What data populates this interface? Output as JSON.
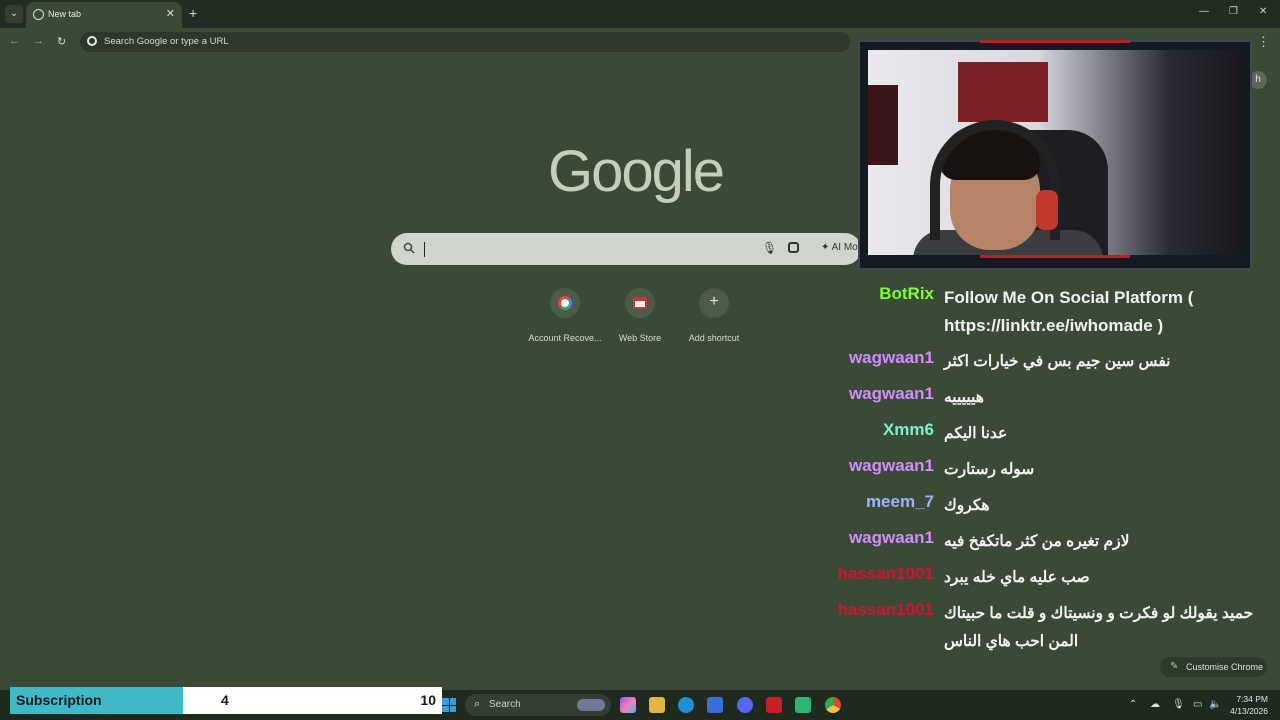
{
  "browser": {
    "tab_title": "New tab",
    "omnibox_placeholder": "Search Google or type a URL",
    "profile_initial": "h"
  },
  "ntp": {
    "logo_text": "Google",
    "search_ai_mode_label": "AI Mo",
    "shortcuts": [
      {
        "label": "Account Recove...",
        "icon": "google-icon"
      },
      {
        "label": "Web Store",
        "icon": "web-store-icon"
      },
      {
        "label": "Add shortcut",
        "icon": "plus-icon"
      }
    ],
    "customise_label": "Customise Chrome"
  },
  "chat": {
    "messages": [
      {
        "user": "BotRix",
        "color": "#7cfc3a",
        "text": "Follow Me On Social Platform ( https://linktr.ee/iwhomade )"
      },
      {
        "user": "wagwaan1",
        "color": "#d28cff",
        "text": "نفس سين جيم بس في خيارات اكثر"
      },
      {
        "user": "wagwaan1",
        "color": "#d28cff",
        "text": "هيييييه"
      },
      {
        "user": "Xmm6",
        "color": "#7ff0c8",
        "text": "عدنا اليكم"
      },
      {
        "user": "wagwaan1",
        "color": "#d28cff",
        "text": "سوله رستارت"
      },
      {
        "user": "meem_7",
        "color": "#9fb3ff",
        "text": "هكروك"
      },
      {
        "user": "wagwaan1",
        "color": "#d28cff",
        "text": "لازم تغيره من كثر ماتكفخ فيه"
      },
      {
        "user": "hassan1001",
        "color": "#d4142d",
        "text": "صب عليه ماي خله يبرد"
      },
      {
        "user": "hassan1001",
        "color": "#d4142d",
        "text": "حميد يقولك لو فكرت و ونسيتاك و قلت ما حبيتاك المن احب هاي الناس"
      }
    ]
  },
  "subscription": {
    "label": "Subscription",
    "current": "4",
    "goal": "10",
    "progress_fraction": 0.4,
    "bar_color": "#3fb9c6"
  },
  "taskbar": {
    "search_label": "Search",
    "time": "7:34 PM",
    "date": "4/13/2026"
  }
}
